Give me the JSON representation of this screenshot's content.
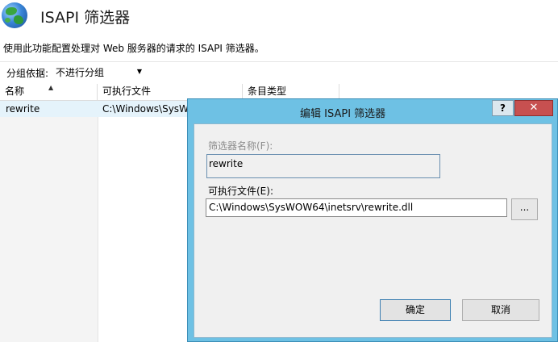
{
  "header": {
    "title": "ISAPI 筛选器",
    "description": "使用此功能配置处理对 Web 服务器的请求的 ISAPI 筛选器。"
  },
  "grouping": {
    "label": "分组依据:",
    "selected": "不进行分组"
  },
  "list": {
    "columns": [
      "名称",
      "可执行文件",
      "条目类型"
    ],
    "rows": [
      {
        "name": "rewrite",
        "executable": "C:\\Windows\\SysW"
      }
    ]
  },
  "dialog": {
    "title": "编辑 ISAPI 筛选器",
    "help_label": "?",
    "close_label": "✕",
    "filter_name_label": "筛选器名称(F):",
    "filter_name_value": "rewrite",
    "exe_label": "可执行文件(E):",
    "exe_value": "C:\\Windows\\SysWOW64\\inetsrv\\rewrite.dll",
    "browse_label": "...",
    "ok_label": "确定",
    "cancel_label": "取消"
  },
  "colors": {
    "dialog_frame": "#6ec1e4",
    "close_button": "#c75050",
    "selected_row": "#e5f3fb"
  },
  "icons": {
    "header": "globe-icon"
  }
}
